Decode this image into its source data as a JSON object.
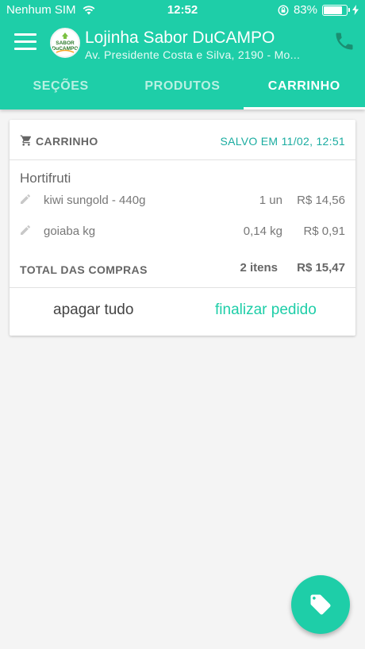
{
  "status_bar": {
    "carrier": "Nenhum SIM",
    "time": "12:52",
    "battery": "83%",
    "battery_level": 0.83
  },
  "header": {
    "store_name": "Lojinha Sabor DuCAMPO",
    "store_address": "Av. Presidente Costa e Silva, 2190 - Mo...",
    "logo_text_top": "SABOR",
    "logo_text_bottom": "DuCAMPO",
    "icons": {
      "menu": "menu-icon",
      "phone": "phone-icon"
    }
  },
  "tabs": [
    {
      "label": "SEÇÕES",
      "active": false
    },
    {
      "label": "PRODUTOS",
      "active": false
    },
    {
      "label": "CARRINHO",
      "active": true
    }
  ],
  "cart": {
    "title": "CARRINHO",
    "saved_label": "SALVO EM 11/02, 12:51",
    "section": "Hortifruti",
    "items": [
      {
        "name": "kiwi sungold - 440g",
        "qty": "1 un",
        "price": "R$ 14,56"
      },
      {
        "name": "goiaba kg",
        "qty": "0,14 kg",
        "price": "R$ 0,91"
      }
    ],
    "total_label": "TOTAL DAS COMPRAS",
    "total_count": "2 itens",
    "total_price": "R$ 15,47",
    "clear_label": "apagar tudo",
    "checkout_label": "finalizar pedido"
  },
  "colors": {
    "primary": "#1ecea8",
    "accent_text": "#1aaca0",
    "background": "#f4f4f4"
  },
  "fab": {
    "icon": "tag-icon"
  }
}
